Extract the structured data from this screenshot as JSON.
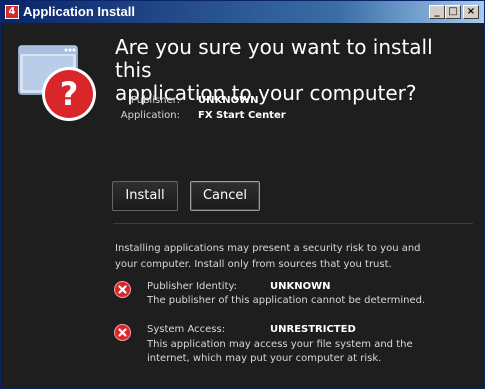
{
  "window": {
    "title": "Application Install",
    "app_icon_glyph": "4",
    "controls": {
      "minimize": "_",
      "maximize": "□",
      "close": "×"
    }
  },
  "dialog": {
    "heading_line1": "Are you sure you want to install this",
    "heading_line2": "application to your computer?",
    "publisher_label": "Publisher:",
    "publisher_value": "UNKNOWN",
    "application_label": "Application:",
    "application_value": "FX Start Center",
    "install_label": "Install",
    "cancel_label": "Cancel",
    "warning_line1": "Installing applications may present a security risk to you and",
    "warning_line2": "your computer. Install only from sources that you trust.",
    "risks": [
      {
        "label": "Publisher Identity:",
        "value": "UNKNOWN",
        "desc_line1": "The publisher of this application cannot be determined.",
        "desc_line2": "",
        "desc_line3": ""
      },
      {
        "label": "System Access:",
        "value": "UNRESTRICTED",
        "desc_line1": "This application may access your file system and the",
        "desc_line2": "internet, which may put your computer at risk.",
        "desc_line3": ""
      }
    ]
  },
  "colors": {
    "background": "#1e1e1e",
    "titlebar_start": "#0a246a",
    "titlebar_end": "#a6caf0",
    "warning_red": "#d9262b",
    "text": "#ffffff"
  },
  "icons": {
    "hero": "install-warning-icon",
    "risk": "error-x-icon"
  }
}
